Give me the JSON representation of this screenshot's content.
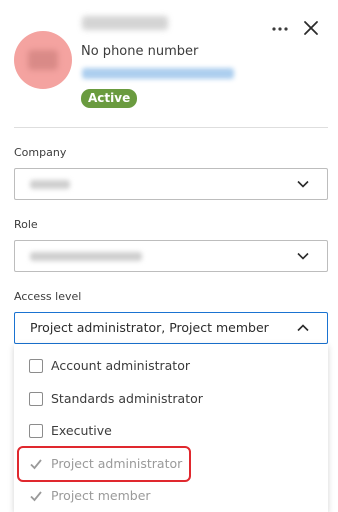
{
  "profile": {
    "phone": "No phone number",
    "status": "Active"
  },
  "fields": {
    "company_label": "Company",
    "role_label": "Role",
    "access_label": "Access level",
    "access_value": "Project administrator,  Project member"
  },
  "access_options": [
    {
      "label": "Account administrator",
      "checked": false,
      "disabled": false
    },
    {
      "label": "Standards administrator",
      "checked": false,
      "disabled": false
    },
    {
      "label": "Executive",
      "checked": false,
      "disabled": false
    },
    {
      "label": "Project administrator",
      "checked": true,
      "disabled": true
    },
    {
      "label": "Project member",
      "checked": true,
      "disabled": true
    }
  ],
  "colors": {
    "active_badge": "#6a9b3f",
    "focus_border": "#1a73d1",
    "highlight": "#e0282e",
    "avatar": "#f4a3a0"
  },
  "icons": [
    "more-horizontal-icon",
    "close-icon",
    "chevron-down-icon",
    "chevron-up-icon",
    "checkmark-icon"
  ]
}
